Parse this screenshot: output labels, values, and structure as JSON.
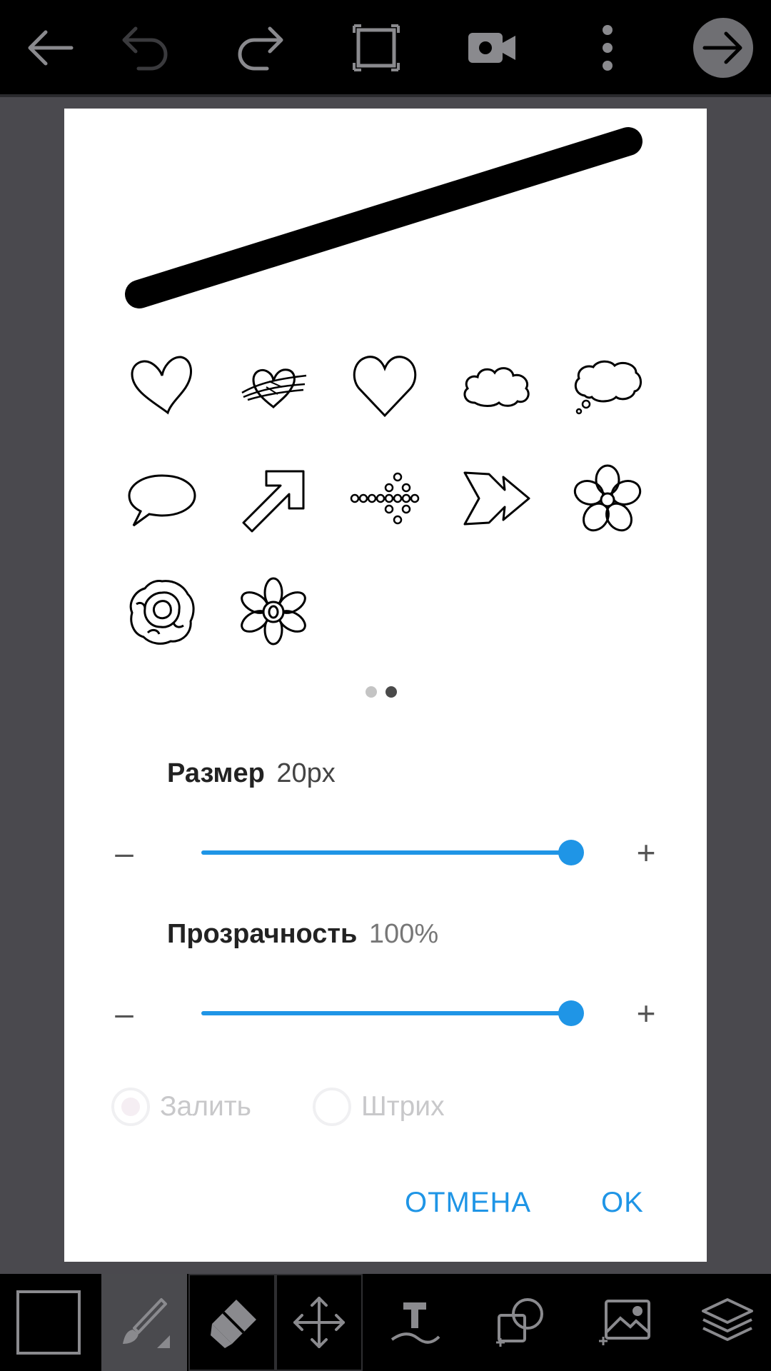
{
  "topbar": {
    "icons": [
      "back-arrow-icon",
      "undo-icon",
      "redo-icon",
      "crop-icon",
      "video-camera-icon",
      "more-vert-icon",
      "next-arrow-icon"
    ]
  },
  "dialog": {
    "shapes_page": 2,
    "shapes_pages_total": 2,
    "shapes": [
      "heart-outline-icon",
      "scribble-heart-icon",
      "heart-icon",
      "cloud-icon",
      "thought-bubble-icon",
      "speech-bubble-icon",
      "diagonal-arrow-icon",
      "dotted-arrow-icon",
      "double-chevron-icon",
      "flower-icon",
      "rose-icon",
      "daisy-icon"
    ],
    "size": {
      "label": "Размер",
      "value": "20px",
      "fraction": 1.0
    },
    "opacity": {
      "label": "Прозрачность",
      "value": "100%",
      "fraction": 1.0
    },
    "minus": "–",
    "plus": "+",
    "fill_option": "Залить",
    "stroke_option": "Штрих",
    "cancel": "ОТМЕНА",
    "ok": "OK"
  },
  "colors": {
    "accent": "#1f95e6"
  },
  "bottombar": {
    "tools": [
      "color-swatch",
      "brush-icon",
      "eraser-icon",
      "move-icon",
      "text-icon",
      "shape-icon",
      "image-icon",
      "layers-icon"
    ]
  }
}
